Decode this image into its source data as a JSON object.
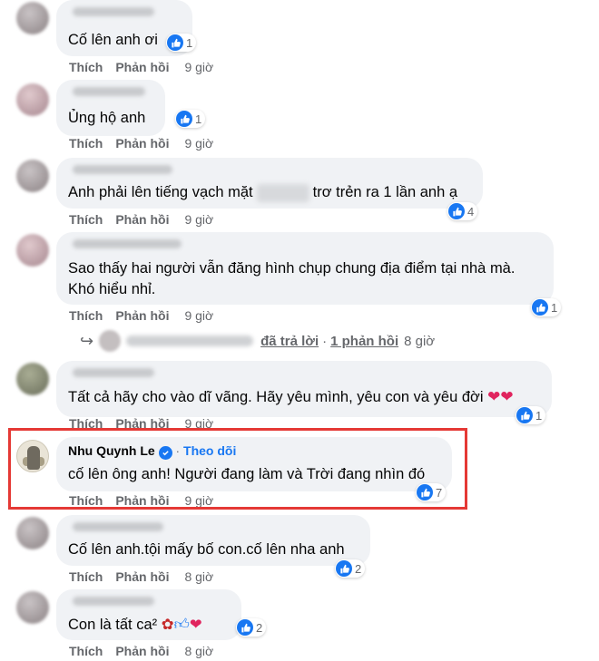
{
  "actions": {
    "like": "Thích",
    "reply": "Phản hồi"
  },
  "comments": [
    {
      "text": "Cố lên anh ơi",
      "time": "9 giờ",
      "reactions": "1"
    },
    {
      "text": "Ủng hộ anh",
      "time": "9 giờ",
      "reactions": "1"
    },
    {
      "text_before": "Anh phải lên tiếng vạch mặt",
      "text_after": "trơ trẻn ra 1 lần anh ạ",
      "time": "9 giờ",
      "reactions": "4"
    },
    {
      "line1": "Sao thấy hai người vẫn đăng hình chụp chung địa điểm tại nhà mà.",
      "line2": "Khó hiểu nhỉ.",
      "time": "9 giờ",
      "reactions": "1"
    },
    {
      "text": "Tất cả hãy cho vào dĩ vãng. Hãy yêu mình, yêu con và yêu đời",
      "time": "9 giờ",
      "reactions": "1"
    },
    {
      "name": "Nhu Quynh Le",
      "follow": "Theo dõi",
      "text": "cố lên ông anh! Người đang làm và Trời đang nhìn đó",
      "time": "9 giờ",
      "reactions": "7"
    },
    {
      "text": "Cố lên anh.tội mấy bố con.cố lên nha anh",
      "time": "8 giờ",
      "reactions": "2"
    },
    {
      "text": "Con là tất ca²",
      "time": "8 giờ",
      "reactions": "2"
    }
  ],
  "reply_thread": {
    "replied": "đã trả lời",
    "dot": "·",
    "count": "1 phản hồi",
    "time": "8 giờ"
  },
  "colors": {
    "accent": "#1877f2",
    "bubble": "#f0f2f5",
    "highlight": "#e53935",
    "meta": "#65676b"
  }
}
